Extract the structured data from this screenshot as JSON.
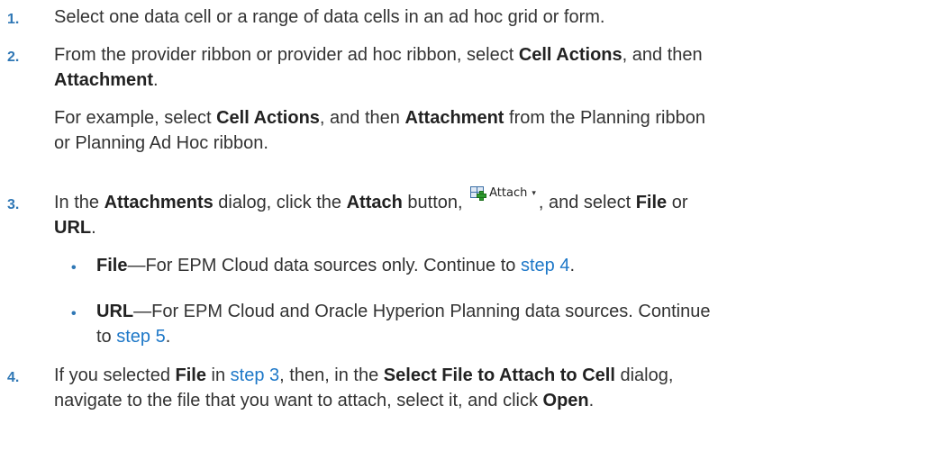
{
  "steps": [
    {
      "number": "1.",
      "lines": [
        {
          "text": "Select one data cell or a range of data cells in an ad hoc grid or form."
        }
      ]
    },
    {
      "number": "2.",
      "lines": [
        {
          "a": "From the provider ribbon or provider ad hoc ribbon, select ",
          "b": "Cell Actions",
          "c": ", and then"
        },
        {
          "a": "Attachment",
          "b": "."
        }
      ],
      "note": [
        {
          "a": "For example, select ",
          "b": "Cell Actions",
          "c": ", and then ",
          "d": "Attachment",
          "e": " from the Planning ribbon"
        },
        {
          "text": "or Planning Ad Hoc ribbon."
        }
      ]
    },
    {
      "number": "3.",
      "lines": [
        {
          "a": "In the ",
          "b": "Attachments",
          "c": " dialog, click the ",
          "d": "Attach",
          "e": " button, ",
          "f": ", and select ",
          "g": "File",
          "h": " or"
        },
        {
          "a": "URL",
          "b": "."
        }
      ],
      "bullets": [
        {
          "term": "File",
          "text": "—For EPM Cloud data sources only. Continue to ",
          "link": "step 4",
          "end": "."
        },
        {
          "term": "URL",
          "text": "—For EPM Cloud and Oracle Hyperion Planning data sources. Continue",
          "line2_link": "step 5",
          "line2_pre": "to ",
          "end": "."
        }
      ]
    },
    {
      "number": "4.",
      "lines": [
        {
          "a": "If you selected ",
          "b": "File",
          "c": " in ",
          "link": "step 3",
          "d": ", then, in the ",
          "e": "Select File to Attach to Cell",
          "f": " dialog,"
        },
        {
          "a": "navigate to the file that you want to attach, select it, and click ",
          "b": "Open",
          "c": "."
        }
      ]
    }
  ],
  "attach_button": {
    "label": "Attach",
    "icon": "attach-cell-icon",
    "caret": "▾"
  },
  "bullet_glyph": "•",
  "colors": {
    "number": "#2f77b5",
    "link": "#1e78c8",
    "text": "#333333"
  }
}
